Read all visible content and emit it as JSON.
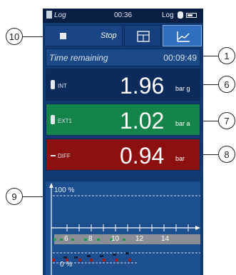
{
  "status": {
    "app": "Log",
    "time": "00:36",
    "mode": "Log"
  },
  "toolbar": {
    "stop_label": "Stop"
  },
  "time_remaining": {
    "label": "Time remaining",
    "value": "00:09:49"
  },
  "channels": [
    {
      "tag": "INT",
      "value": "1.96",
      "unit": "bar g",
      "color": "#0d2b5a"
    },
    {
      "tag": "EXT1",
      "value": "1.02",
      "unit": "bar a",
      "color": "#15844a"
    },
    {
      "tag": "DIFF",
      "value": "0.94",
      "unit": "bar",
      "color": "#8c1010"
    }
  ],
  "chart": {
    "top_label": "100 %",
    "bottom_label": "0 %",
    "x_ticks": [
      "6",
      "8",
      "10",
      "12",
      "14"
    ]
  },
  "callouts": [
    "10",
    "1",
    "6",
    "7",
    "8",
    "9"
  ]
}
